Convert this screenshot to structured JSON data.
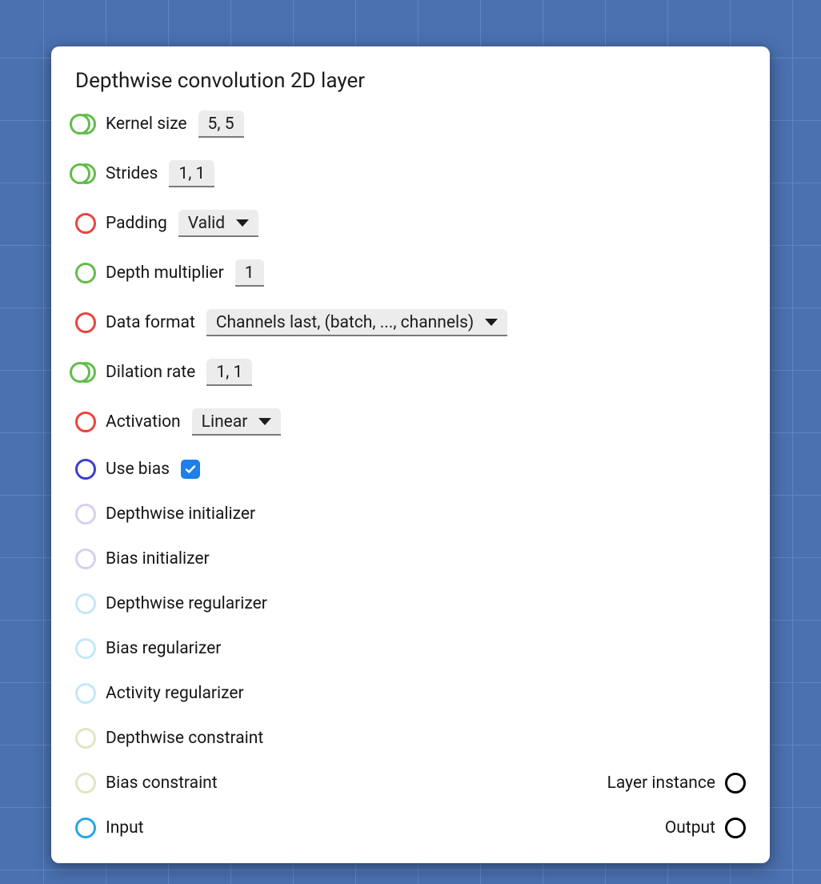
{
  "title": "Depthwise convolution 2D layer",
  "rows": {
    "kernel_size": {
      "label": "Kernel size",
      "value": "5, 5"
    },
    "strides": {
      "label": "Strides",
      "value": "1, 1"
    },
    "padding": {
      "label": "Padding",
      "value": "Valid"
    },
    "depth_mult": {
      "label": "Depth multiplier",
      "value": "1"
    },
    "data_format": {
      "label": "Data format",
      "value": "Channels last, (batch, ..., channels)"
    },
    "dilation_rate": {
      "label": "Dilation rate",
      "value": "1, 1"
    },
    "activation": {
      "label": "Activation",
      "value": "Linear"
    },
    "use_bias": {
      "label": "Use bias",
      "checked": true
    },
    "depth_init": {
      "label": "Depthwise initializer"
    },
    "bias_init": {
      "label": "Bias initializer"
    },
    "depth_reg": {
      "label": "Depthwise regularizer"
    },
    "bias_reg": {
      "label": "Bias regularizer"
    },
    "activity_reg": {
      "label": "Activity regularizer"
    },
    "depth_con": {
      "label": "Depthwise constraint"
    },
    "bias_con": {
      "label": "Bias constraint"
    },
    "input": {
      "label": "Input"
    }
  },
  "outputs": {
    "layer_instance": {
      "label": "Layer instance"
    },
    "output": {
      "label": "Output"
    }
  }
}
